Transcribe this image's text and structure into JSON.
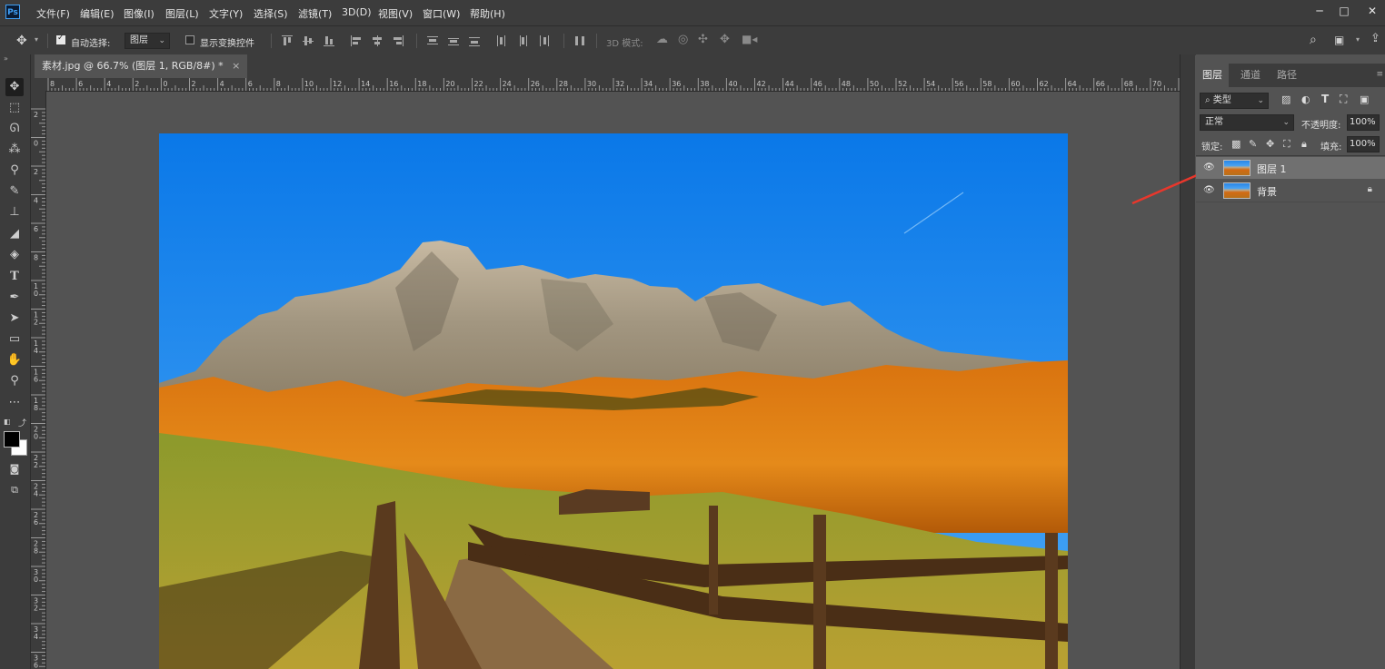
{
  "app": {
    "logo_text": "Ps"
  },
  "menu": {
    "items": [
      "文件(F)",
      "编辑(E)",
      "图像(I)",
      "图层(L)",
      "文字(Y)",
      "选择(S)",
      "滤镜(T)",
      "3D(D)",
      "视图(V)",
      "窗口(W)",
      "帮助(H)"
    ]
  },
  "window_controls": {
    "minimize": "─",
    "maximize": "□",
    "close": "✕"
  },
  "options_bar": {
    "auto_select_label": "自动选择:",
    "auto_select_checked": true,
    "auto_select_target": "图层",
    "show_transform_label": "显示变换控件",
    "show_transform_checked": false,
    "mode_3d_label": "3D 模式:"
  },
  "document": {
    "tab_title": "素材.jpg @ 66.7% (图层 1, RGB/8#) *",
    "close_glyph": "×"
  },
  "rulers": {
    "top_labels": [
      "8",
      "6",
      "4",
      "2",
      "0",
      "2",
      "4",
      "6",
      "8",
      "10",
      "12",
      "14",
      "16",
      "18",
      "20",
      "22",
      "24",
      "26",
      "28",
      "30",
      "32",
      "34",
      "36",
      "38",
      "40",
      "42",
      "44",
      "46",
      "48",
      "50",
      "52",
      "54",
      "56",
      "58",
      "60",
      "62",
      "64",
      "66",
      "68",
      "70",
      "72"
    ],
    "left_labels": [
      "2",
      "0",
      "2",
      "4",
      "6",
      "8",
      "1 0",
      "1 2",
      "1 4",
      "1 6",
      "1 8",
      "2 0",
      "2 2",
      "2 4",
      "2 6",
      "2 8",
      "3 0",
      "3 2",
      "3 4",
      "3 6"
    ]
  },
  "layers_panel": {
    "tabs": [
      {
        "label": "图层",
        "active": true
      },
      {
        "label": "通道",
        "active": false
      },
      {
        "label": "路径",
        "active": false
      }
    ],
    "filter_kind": "类型",
    "blend_mode": "正常",
    "opacity_label": "不透明度:",
    "opacity_value": "100%",
    "lock_label": "锁定:",
    "fill_label": "填充:",
    "fill_value": "100%",
    "layers": [
      {
        "name": "图层 1",
        "selected": true,
        "visible": true,
        "locked": false
      },
      {
        "name": "背景",
        "selected": false,
        "visible": true,
        "locked": true
      }
    ]
  },
  "colors": {
    "ui_dark": "#3c3c3c",
    "ui_mid": "#535353",
    "annotation_arrow": "#e8372c",
    "foreground_swatch": "#000000",
    "background_swatch": "#ffffff"
  },
  "tools": [
    "move-icon",
    "marquee-icon",
    "lasso-icon",
    "magic-wand-icon",
    "eyedropper-icon",
    "brush-icon",
    "stamp-icon",
    "eraser-icon",
    "bucket-icon",
    "type-icon",
    "pen-icon",
    "path-select-icon",
    "shape-icon",
    "hand-icon",
    "zoom-icon",
    "more-tools-icon"
  ]
}
